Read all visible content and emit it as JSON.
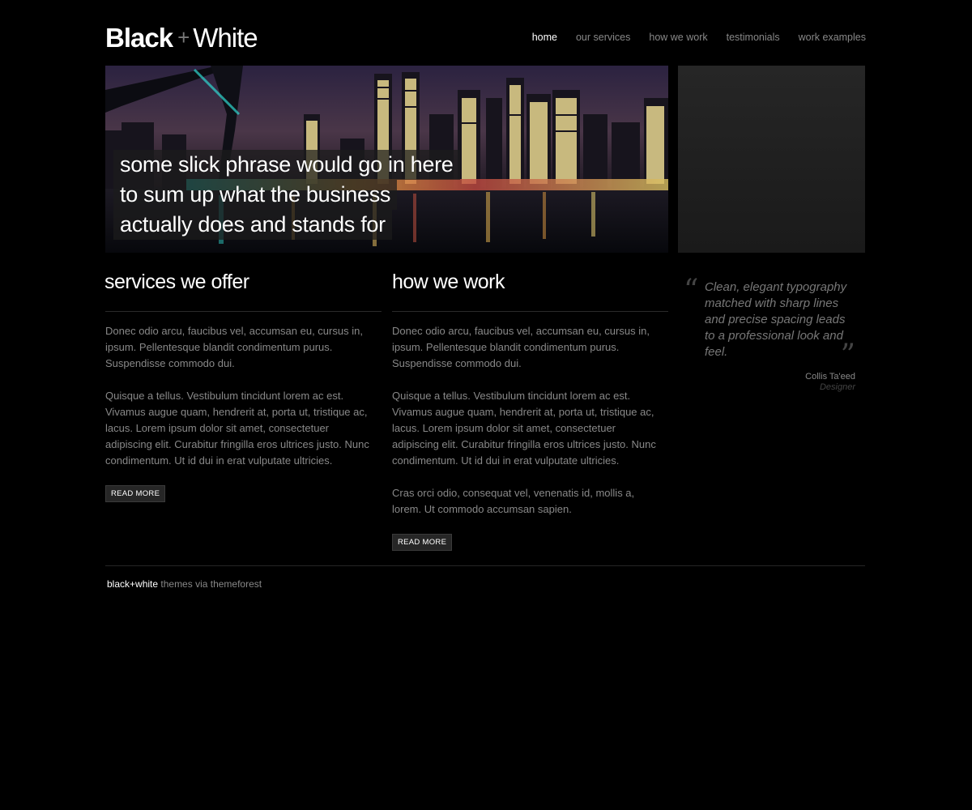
{
  "logo": {
    "bold": "Black",
    "plus": "+",
    "light": "White"
  },
  "nav": [
    {
      "label": "home",
      "active": true
    },
    {
      "label": "our services",
      "active": false
    },
    {
      "label": "how we work",
      "active": false
    },
    {
      "label": "testimonials",
      "active": false
    },
    {
      "label": "work examples",
      "active": false
    }
  ],
  "hero": {
    "lines": [
      "some slick phrase would go in here",
      "to sum up what the business",
      "actually does and stands for"
    ]
  },
  "services": {
    "title": "services we offer",
    "paragraphs": [
      "Donec odio arcu, faucibus vel, accumsan eu, cursus in, ipsum. Pellentesque blandit condimentum purus. Suspendisse commodo dui.",
      "Quisque a tellus. Vestibulum tincidunt lorem ac est. Vivamus augue quam, hendrerit at, porta ut, tristique ac, lacus. Lorem ipsum dolor sit amet, consectetuer adipiscing elit. Curabitur fringilla eros ultrices justo. Nunc condimentum. Ut id dui in erat vulputate ultricies."
    ],
    "button": "READ MORE"
  },
  "how": {
    "title": "how we work",
    "paragraphs": [
      "Donec odio arcu, faucibus vel, accumsan eu, cursus in, ipsum. Pellentesque blandit condimentum purus. Suspendisse commodo dui.",
      "Quisque a tellus. Vestibulum tincidunt lorem ac est. Vivamus augue quam, hendrerit at, porta ut, tristique ac, lacus. Lorem ipsum dolor sit amet, consectetuer adipiscing elit. Curabitur fringilla eros ultrices justo. Nunc condimentum. Ut id dui in erat vulputate ultricies.",
      "Cras orci odio, consequat vel, venenatis id, mollis a, lorem. Ut commodo accumsan sapien."
    ],
    "button": "READ MORE"
  },
  "testimonial": {
    "text": "Clean, elegant typography matched with sharp lines and precise spacing leads to a professional look and feel.",
    "author": "Collis Ta'eed",
    "role": "Designer"
  },
  "footer": {
    "brand": "black+white",
    "rest": " themes via themeforest"
  },
  "colors": {
    "background": "#000000",
    "text": "#888888",
    "heading": "#ffffff"
  }
}
